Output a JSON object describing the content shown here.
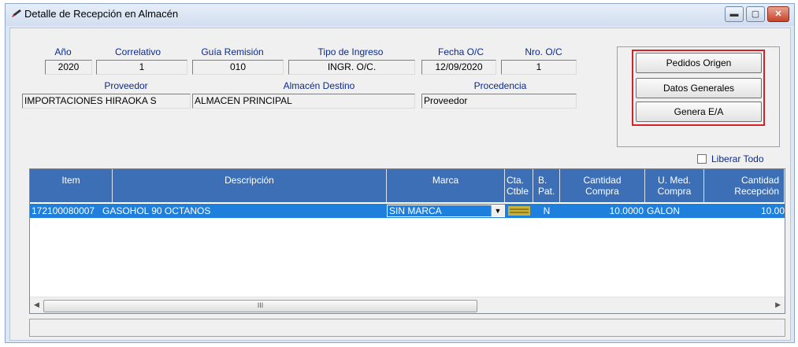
{
  "window": {
    "title": "Detalle de Recepción en Almacén",
    "icon": "pencil-icon",
    "controls": {
      "minimize": "▬",
      "maximize": "▢",
      "close": "✕"
    }
  },
  "header": {
    "anio": {
      "label": "Año",
      "value": "2020"
    },
    "correlativo": {
      "label": "Correlativo",
      "value": "1"
    },
    "guia": {
      "label": "Guía Remisión",
      "value": "010"
    },
    "tipo_ingreso": {
      "label": "Tipo de Ingreso",
      "value": "INGR. O/C."
    },
    "fecha_oc": {
      "label": "Fecha O/C",
      "value": "12/09/2020"
    },
    "nro_oc": {
      "label": "Nro. O/C",
      "value": "1"
    },
    "proveedor": {
      "label": "Proveedor",
      "value": "IMPORTACIONES HIRAOKA S"
    },
    "almacen_destino": {
      "label": "Almacén Destino",
      "value": "ALMACEN PRINCIPAL"
    },
    "procedencia": {
      "label": "Procedencia",
      "value": "Proveedor"
    }
  },
  "buttons": {
    "pedidos_origen": "Pedidos Origen",
    "datos_generales": "Datos Generales",
    "genera_ea": "Genera E/A"
  },
  "liberar_todo": {
    "label": "Liberar Todo",
    "checked": false
  },
  "grid": {
    "columns": {
      "item": "Item",
      "descripcion": "Descripción",
      "marca": "Marca",
      "cta1": "Cta.",
      "cta2": "Ctble",
      "bpat1": "B.",
      "bpat2": "Pat.",
      "cant_compra1": "Cantidad",
      "cant_compra2": "Compra",
      "umed1": "U. Med.",
      "umed2": "Compra",
      "cant_recep1": "Cantidad",
      "cant_recep2": "Recepción"
    },
    "rows": [
      {
        "item": "172100080007",
        "descripcion": "GASOHOL 90 OCTANOS",
        "marca": "SIN MARCA",
        "cta_icon": "account-lookup-icon",
        "bpat": "N",
        "cantidad_compra": "10.0000",
        "umed": "GALON",
        "cantidad_recepcion": "10.00"
      }
    ],
    "scroll_thumb": "III"
  },
  "colors": {
    "header_bg": "#3c6fb6",
    "selected_row": "#1f7fdd",
    "highlight_border": "#d6202a",
    "label_text": "#0a2a8c"
  }
}
